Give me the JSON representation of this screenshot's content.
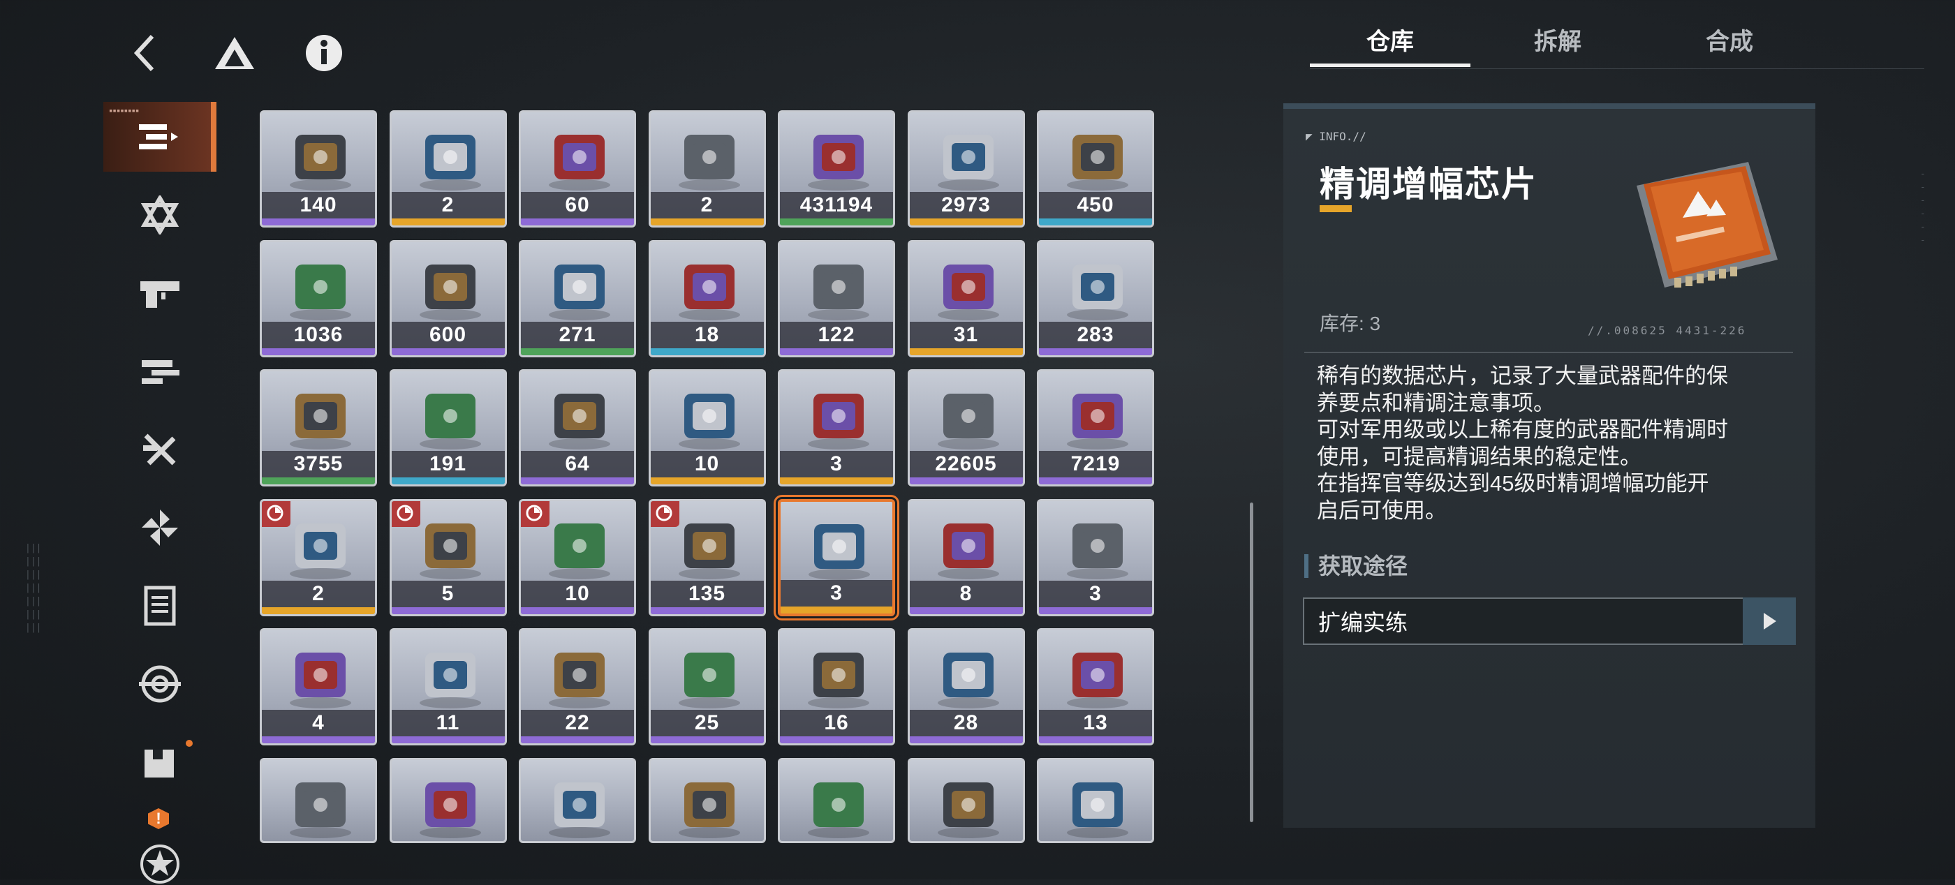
{
  "topbar": {
    "back_icon": "back-chevron-icon",
    "home_icon": "triangle-logo-icon",
    "info_icon": "info-icon"
  },
  "sidebar": {
    "items": [
      {
        "name": "sidebar-item-all",
        "icon": "list-icon",
        "active": true
      },
      {
        "name": "sidebar-item-stars",
        "icon": "hexagram-icon"
      },
      {
        "name": "sidebar-item-weapons",
        "icon": "gun-icon"
      },
      {
        "name": "sidebar-item-parts",
        "icon": "parts-icon"
      },
      {
        "name": "sidebar-item-tools",
        "icon": "crossed-tools-icon"
      },
      {
        "name": "sidebar-item-collection",
        "icon": "pinwheel-icon"
      },
      {
        "name": "sidebar-item-documents",
        "icon": "document-icon"
      },
      {
        "name": "sidebar-item-target",
        "icon": "target-icon"
      },
      {
        "name": "sidebar-item-box",
        "icon": "box-icon"
      },
      {
        "name": "sidebar-item-special",
        "icon": "star-circle-icon"
      }
    ]
  },
  "grid": {
    "items": [
      {
        "count": "140",
        "rarity": "#8e6bd6",
        "icon": "powder-icon"
      },
      {
        "count": "2",
        "rarity": "#e6a52a",
        "icon": "ingot-stack-icon"
      },
      {
        "count": "60",
        "rarity": "#8e6bd6",
        "icon": "battery-icon"
      },
      {
        "count": "2",
        "rarity": "#e6a52a",
        "icon": "vial-case-icon"
      },
      {
        "count": "431194",
        "rarity": "#4fa35a",
        "icon": "circuit-card-icon"
      },
      {
        "count": "2973",
        "rarity": "#e6a52a",
        "icon": "canister-icon"
      },
      {
        "count": "450",
        "rarity": "#3fa8c9",
        "icon": "gold-token-icon"
      },
      {
        "count": "1036",
        "rarity": "#8e6bd6",
        "icon": "ring-device-icon"
      },
      {
        "count": "600",
        "rarity": "#8e6bd6",
        "icon": "disc-device-icon"
      },
      {
        "count": "271",
        "rarity": "#4fa35a",
        "icon": "green-card-icon"
      },
      {
        "count": "18",
        "rarity": "#3fa8c9",
        "icon": "blue-card-icon"
      },
      {
        "count": "122",
        "rarity": "#8e6bd6",
        "icon": "purple-card-icon"
      },
      {
        "count": "31",
        "rarity": "#e6a52a",
        "icon": "purple-card-icon"
      },
      {
        "count": "283",
        "rarity": "#8e6bd6",
        "icon": "capsule-icon"
      },
      {
        "count": "3755",
        "rarity": "#4fa35a",
        "icon": "green-capsule-icon"
      },
      {
        "count": "191",
        "rarity": "#3fa8c9",
        "icon": "blue-capsule-icon"
      },
      {
        "count": "64",
        "rarity": "#8e6bd6",
        "icon": "purple-capsule-icon"
      },
      {
        "count": "10",
        "rarity": "#e6a52a",
        "icon": "gold-capsule-icon"
      },
      {
        "count": "3",
        "rarity": "#e6a52a",
        "icon": "orb-core-icon"
      },
      {
        "count": "22605",
        "rarity": "#8e6bd6",
        "icon": "silver-coin-icon"
      },
      {
        "count": "7219",
        "rarity": "#8e6bd6",
        "icon": "plant-cube-icon"
      },
      {
        "count": "2",
        "rarity": "#e6a52a",
        "icon": "gamepad-icon",
        "limited": true
      },
      {
        "count": "5",
        "rarity": "#8e6bd6",
        "icon": "badge-disc-icon",
        "limited": true
      },
      {
        "count": "10",
        "rarity": "#8e6bd6",
        "icon": "plush-bear-icon",
        "limited": true
      },
      {
        "count": "135",
        "rarity": "#8e6bd6",
        "icon": "glass-sphere-icon",
        "limited": true
      },
      {
        "count": "3",
        "rarity": "#e6a52a",
        "icon": "chip-icon",
        "selected": true
      },
      {
        "count": "8",
        "rarity": "#8e6bd6",
        "icon": "ammo-gear-icon"
      },
      {
        "count": "3",
        "rarity": "#8e6bd6",
        "icon": "folder-icon"
      },
      {
        "count": "4",
        "rarity": "#8e6bd6",
        "icon": "ticket-icon"
      },
      {
        "count": "11",
        "rarity": "#8e6bd6",
        "icon": "knife-icon"
      },
      {
        "count": "22",
        "rarity": "#8e6bd6",
        "icon": "id-badge-icon"
      },
      {
        "count": "25",
        "rarity": "#8e6bd6",
        "icon": "battery-pack-icon"
      },
      {
        "count": "16",
        "rarity": "#8e6bd6",
        "icon": "neon-poster-icon"
      },
      {
        "count": "28",
        "rarity": "#8e6bd6",
        "icon": "gold-lion-icon"
      },
      {
        "count": "13",
        "rarity": "#8e6bd6",
        "icon": "toy-crocodile-icon"
      },
      {
        "count": "",
        "rarity": "#8e6bd6",
        "icon": "profile-card-icon"
      },
      {
        "count": "",
        "rarity": "#8e6bd6",
        "icon": "ballet-shoes-icon"
      },
      {
        "count": "",
        "rarity": "#8e6bd6",
        "icon": "photo-icon"
      },
      {
        "count": "",
        "rarity": "#8e6bd6",
        "icon": "envelope-icon"
      },
      {
        "count": "",
        "rarity": "#8e6bd6",
        "icon": "cat-headphones-icon"
      },
      {
        "count": "",
        "rarity": "#8e6bd6",
        "icon": "police-badge-icon"
      },
      {
        "count": "",
        "rarity": "#8e6bd6",
        "icon": "crystal-pendant-icon"
      }
    ]
  },
  "tabs": [
    {
      "label": "仓库",
      "active": true
    },
    {
      "label": "拆解"
    },
    {
      "label": "合成"
    }
  ],
  "detail": {
    "info_tag": "INFO.//",
    "name": "精调增幅芯片",
    "stock": "库存: 3",
    "code": "//.008625   4431-226",
    "description": [
      "稀有的数据芯片，记录了大量武器配件的保",
      "养要点和精调注意事项。",
      "可对军用级或以上稀有度的武器配件精调时",
      "使用，可提高精调结果的稳定性。",
      "在指挥官等级达到45级时精调增幅功能开",
      "启后可使用。"
    ],
    "source_title": "获取途径",
    "source_button": "扩编实练",
    "accent": "#e6a52a",
    "selected_border": "#e8782e"
  }
}
